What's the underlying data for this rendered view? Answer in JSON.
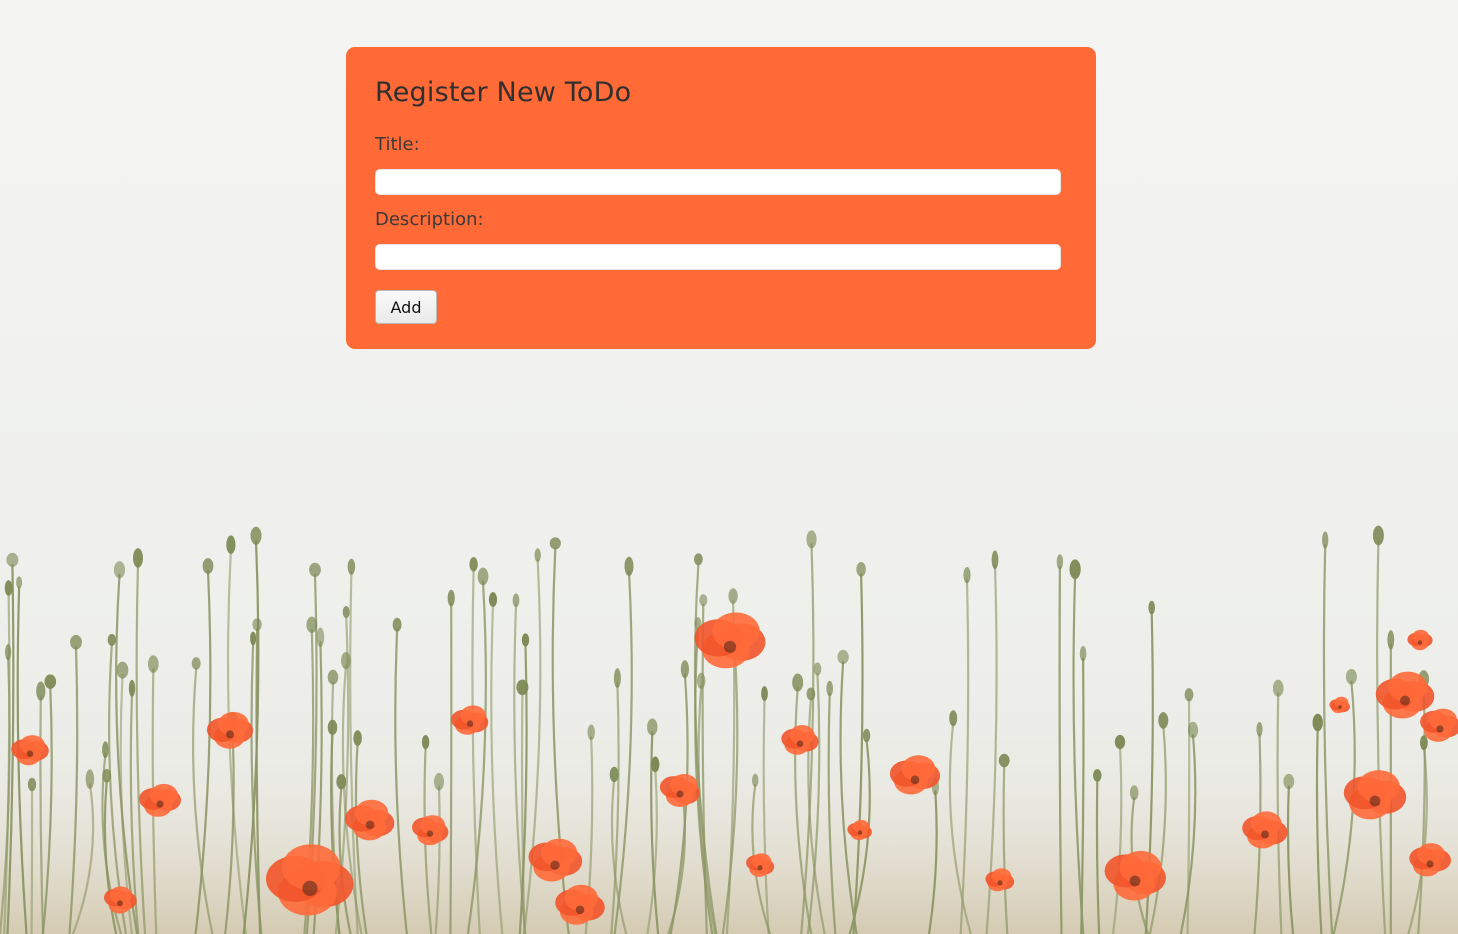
{
  "form": {
    "heading": "Register New ToDo",
    "title_label": "Title:",
    "title_value": "",
    "description_label": "Description:",
    "description_value": "",
    "add_label": "Add"
  },
  "colors": {
    "card_background": "#ff6a37",
    "page_background": "#f2f3f1",
    "poppy_red": "#ff5a2a",
    "stem_green": "#7d8a56"
  },
  "background": {
    "subject": "poppy-field-photo"
  }
}
